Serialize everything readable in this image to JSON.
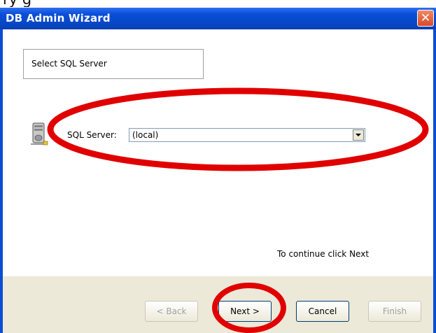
{
  "top_caption": "ry                                                           g",
  "window": {
    "title": "DB Admin Wizard",
    "close_glyph": "✕"
  },
  "step": {
    "title": "Select SQL Server"
  },
  "server": {
    "label": "SQL Server:",
    "value": "(local)"
  },
  "hint": "To continue click Next",
  "buttons": {
    "back": "< Back",
    "next": "Next >",
    "cancel": "Cancel",
    "finish": "Finish"
  },
  "colors": {
    "annotation": "#e00000",
    "titlebar": "#0a4ed8",
    "footer": "#ece9d8"
  }
}
